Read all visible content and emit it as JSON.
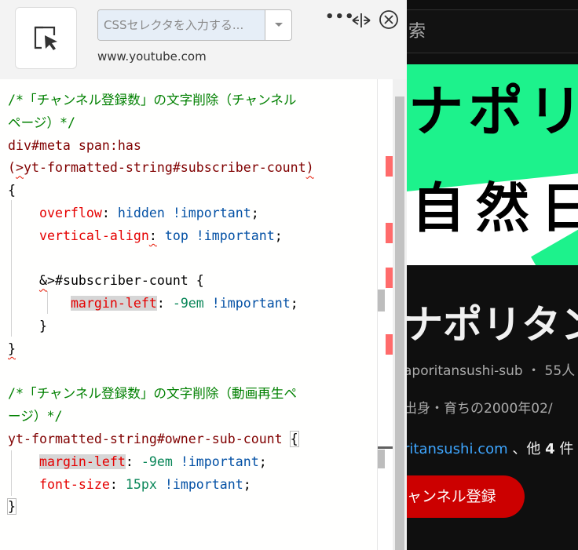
{
  "extension": {
    "selector_placeholder": "CSSセレクタを入力する...",
    "site_host": "www.youtube.com",
    "more_label": "•••",
    "icons": {
      "picker": "element-picker-icon",
      "dropdown": "chevron-down-icon",
      "resize": "horizontal-resize-icon",
      "close": "close-circle-icon"
    }
  },
  "code": {
    "lines": [
      [
        {
          "t": "/*「チャンネル登録数」の文字削除（チャンネル",
          "c": "c-comment"
        }
      ],
      [
        {
          "t": "ページ）*/",
          "c": "c-comment"
        }
      ],
      [
        {
          "t": "div#meta span:has",
          "c": "c-sel"
        }
      ],
      [
        {
          "t": "(",
          "c": "c-sel"
        },
        {
          "t": ">",
          "c": "c-sel squig"
        },
        {
          "t": "yt-formatted-string#subscriber-count",
          "c": "c-sel"
        },
        {
          "t": ")",
          "c": "c-sel squig"
        }
      ],
      [
        {
          "t": "{",
          "c": "c-punc"
        }
      ],
      [
        {
          "t": "    ",
          "c": ""
        },
        {
          "t": "overflow",
          "c": "c-prop"
        },
        {
          "t": ": ",
          "c": "c-punc"
        },
        {
          "t": "hidden !important",
          "c": "c-kw"
        },
        {
          "t": ";",
          "c": "c-punc"
        }
      ],
      [
        {
          "t": "    ",
          "c": ""
        },
        {
          "t": "vertical-align",
          "c": "c-prop"
        },
        {
          "t": ":",
          "c": "c-punc squig"
        },
        {
          "t": " ",
          "c": ""
        },
        {
          "t": "top !important",
          "c": "c-kw"
        },
        {
          "t": ";",
          "c": "c-punc"
        }
      ],
      [
        {
          "t": "",
          "c": ""
        }
      ],
      [
        {
          "t": "    ",
          "c": ""
        },
        {
          "t": "&",
          "c": "c-punc squig"
        },
        {
          "t": ">#subscriber-count {",
          "c": "c-punc"
        }
      ],
      [
        {
          "t": "        ",
          "c": ""
        },
        {
          "t": "margin-left",
          "c": "c-prop c-hl"
        },
        {
          "t": ": ",
          "c": "c-punc"
        },
        {
          "t": "-9em",
          "c": "c-num"
        },
        {
          "t": " ",
          "c": ""
        },
        {
          "t": "!important",
          "c": "c-kw"
        },
        {
          "t": ";",
          "c": "c-punc"
        }
      ],
      [
        {
          "t": "    ",
          "c": ""
        },
        {
          "t": "}",
          "c": "c-punc"
        }
      ],
      [
        {
          "t": "}",
          "c": "c-punc squig"
        }
      ],
      [
        {
          "t": "",
          "c": ""
        }
      ],
      [
        {
          "t": "/*「チャンネル登録数」の文字削除（動画再生ペ",
          "c": "c-comment"
        }
      ],
      [
        {
          "t": "ージ）*/",
          "c": "c-comment"
        }
      ],
      [
        {
          "t": "yt-formatted-string#owner-sub-count ",
          "c": "c-sel"
        },
        {
          "t": "{",
          "c": "c-punc c-brace-box"
        }
      ],
      [
        {
          "t": "    ",
          "c": ""
        },
        {
          "t": "margin-left",
          "c": "c-prop c-hl"
        },
        {
          "t": ": ",
          "c": "c-punc"
        },
        {
          "t": "-9em",
          "c": "c-num"
        },
        {
          "t": " ",
          "c": ""
        },
        {
          "t": "!important",
          "c": "c-kw"
        },
        {
          "t": ";",
          "c": "c-punc"
        }
      ],
      [
        {
          "t": "    ",
          "c": ""
        },
        {
          "t": "font-size",
          "c": "c-prop"
        },
        {
          "t": ": ",
          "c": "c-punc"
        },
        {
          "t": "15px",
          "c": "c-num"
        },
        {
          "t": " ",
          "c": ""
        },
        {
          "t": "!important",
          "c": "c-kw"
        },
        {
          "t": ";",
          "c": "c-punc"
        }
      ],
      [
        {
          "t": "}",
          "c": "c-punc c-brace-box"
        }
      ]
    ]
  },
  "youtube": {
    "search_text": "索",
    "banner_line1": "ナポリ",
    "banner_line2": "自然日",
    "channel_name": "ナポリタン",
    "handle_line": "aporitansushi-sub ・ 55人",
    "description": "出身・育ちの2000年02/",
    "link_text": "ritansushi.com",
    "links_suffix_pre": " 、他 ",
    "links_suffix_num": "4",
    "links_suffix_post": " 件",
    "subscribe_label": "ャンネル登録"
  },
  "colors": {
    "banner_green": "#1df28c",
    "subscribe_red": "#cc0000",
    "link_blue": "#3ea6ff",
    "diff_marker": "#ff6b6b"
  }
}
